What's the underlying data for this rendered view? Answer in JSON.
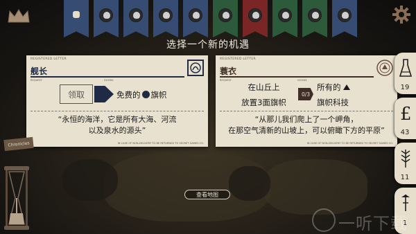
{
  "header": {
    "flags": [
      {
        "name": "parchment-banner",
        "color": "#364c73"
      },
      {
        "name": "character-banner-1",
        "color": "#364c73"
      },
      {
        "name": "character-banner-2",
        "color": "#364c73"
      },
      {
        "name": "character-banner-3",
        "color": "#364c73"
      },
      {
        "name": "character-banner-4",
        "color": "#364c73"
      },
      {
        "name": "character-banner-5",
        "color": "#2c5a3a"
      },
      {
        "name": "character-banner-6",
        "color": "#7b2626"
      },
      {
        "name": "character-banner-7",
        "color": "#2c5a3a"
      },
      {
        "name": "character-banner-8",
        "color": "#2c5a3a"
      },
      {
        "name": "character-banner-9",
        "color": "#364c73"
      }
    ]
  },
  "title": "选择一个新的机遇",
  "cards": [
    {
      "registered": "REGISTERED LETTER",
      "title": "舰长",
      "request_label": "REQUEST",
      "goods_label": "GOODS",
      "request_button": "领取",
      "goods_prefix": "免费的",
      "goods_suffix": "旗帜",
      "quote_line1": "“永恒的海洋，它是所有大海、河流",
      "quote_line2": "以及泉水的源头”",
      "footer": "IN CASE OF NON-DELIVERY TO BE RETURNED TO SECRET GAMES CO."
    },
    {
      "registered": "REGISTERED LETTER",
      "title": "蓑衣",
      "request_label": "REQUEST",
      "goods_label": "GOODS",
      "request_line1": "在山丘上",
      "request_line2": "放置3面旗帜",
      "progress": "0/3",
      "goods_line1": "所有的",
      "goods_line2": "旗帜科技",
      "quote_line1": "“从那儿我们爬上了一个岬角，",
      "quote_line2": "在那空气清新的山坡上，可以俯瞰下方的平原”",
      "footer": "IN CASE OF NON-DELIVERY TO BE RETURNED TO SECRET GAMES CO."
    }
  ],
  "resources": [
    {
      "icon": "flask-icon",
      "value": "19"
    },
    {
      "icon": "pound-icon",
      "value": "43"
    },
    {
      "icon": "wheat-icon",
      "value": "11"
    },
    {
      "icon": "tool-icon",
      "value": "1"
    }
  ],
  "stamp_text": "Chronicles",
  "view_map": "查看地图",
  "watermark": "一听下载"
}
